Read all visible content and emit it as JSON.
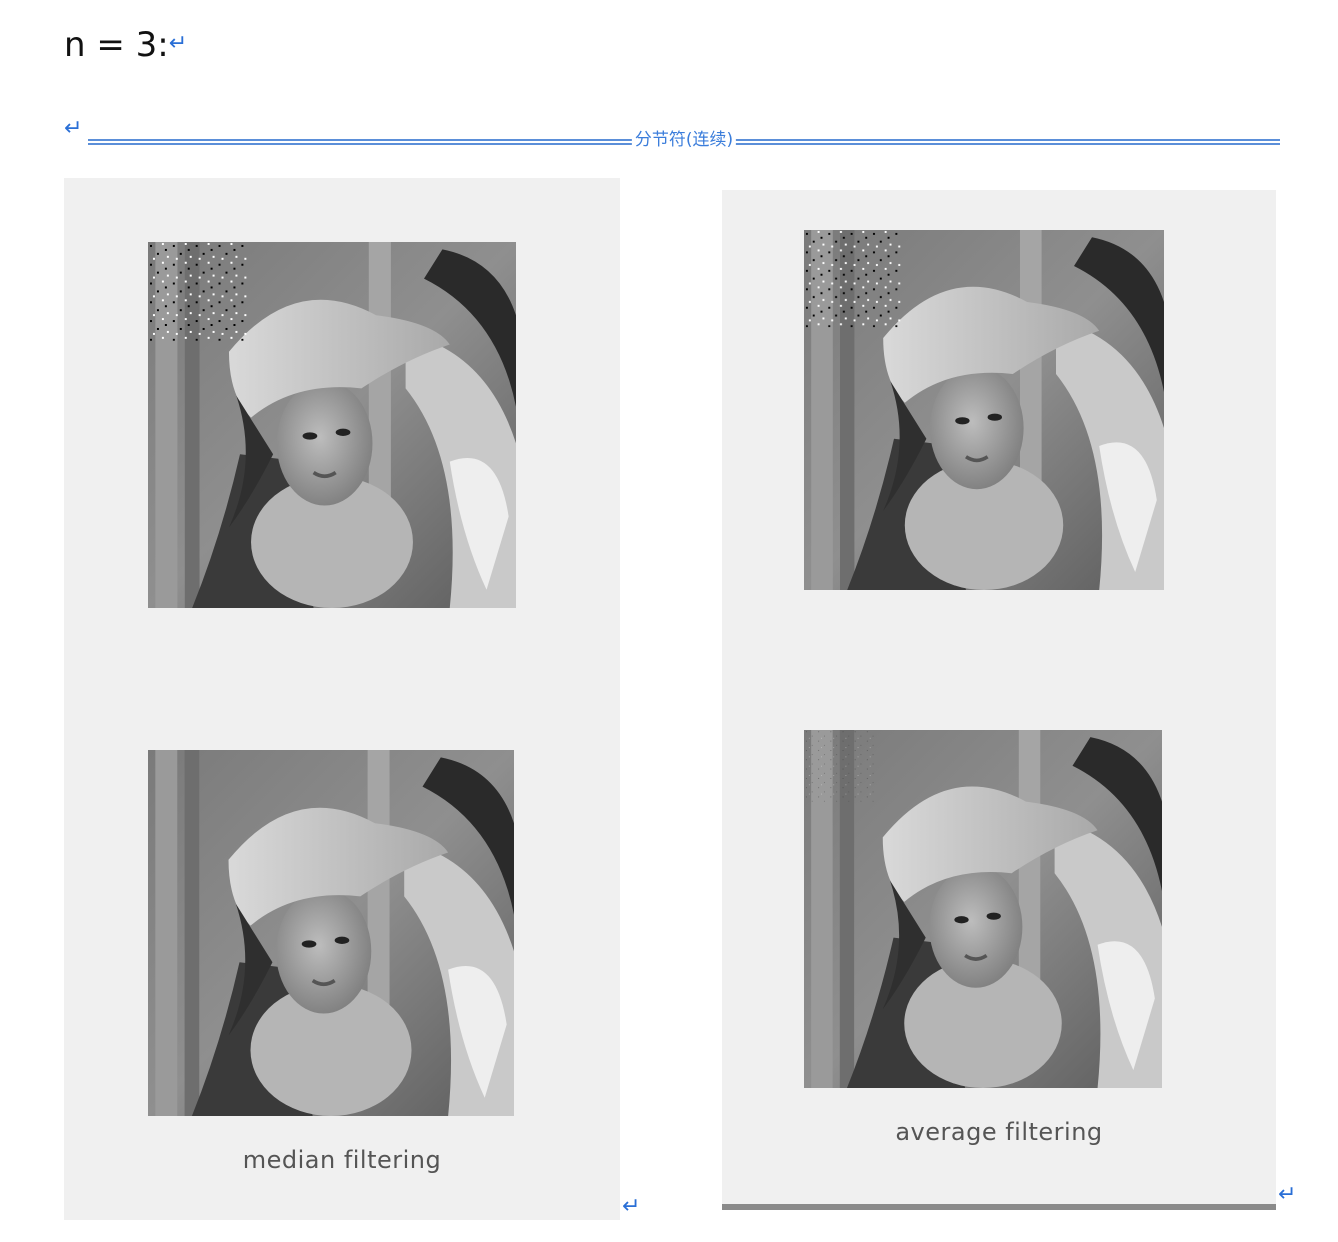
{
  "heading": {
    "text": "n = 3:"
  },
  "section_break": {
    "label": "分节符(连续)"
  },
  "figures": [
    {
      "caption": "median filtering"
    },
    {
      "caption": "average filtering"
    }
  ],
  "marks": {
    "paragraph": "↵"
  },
  "colors": {
    "mark": "#2a6fd6",
    "section_line": "#5b8fd9",
    "figure_bg": "#f0f0f0"
  }
}
